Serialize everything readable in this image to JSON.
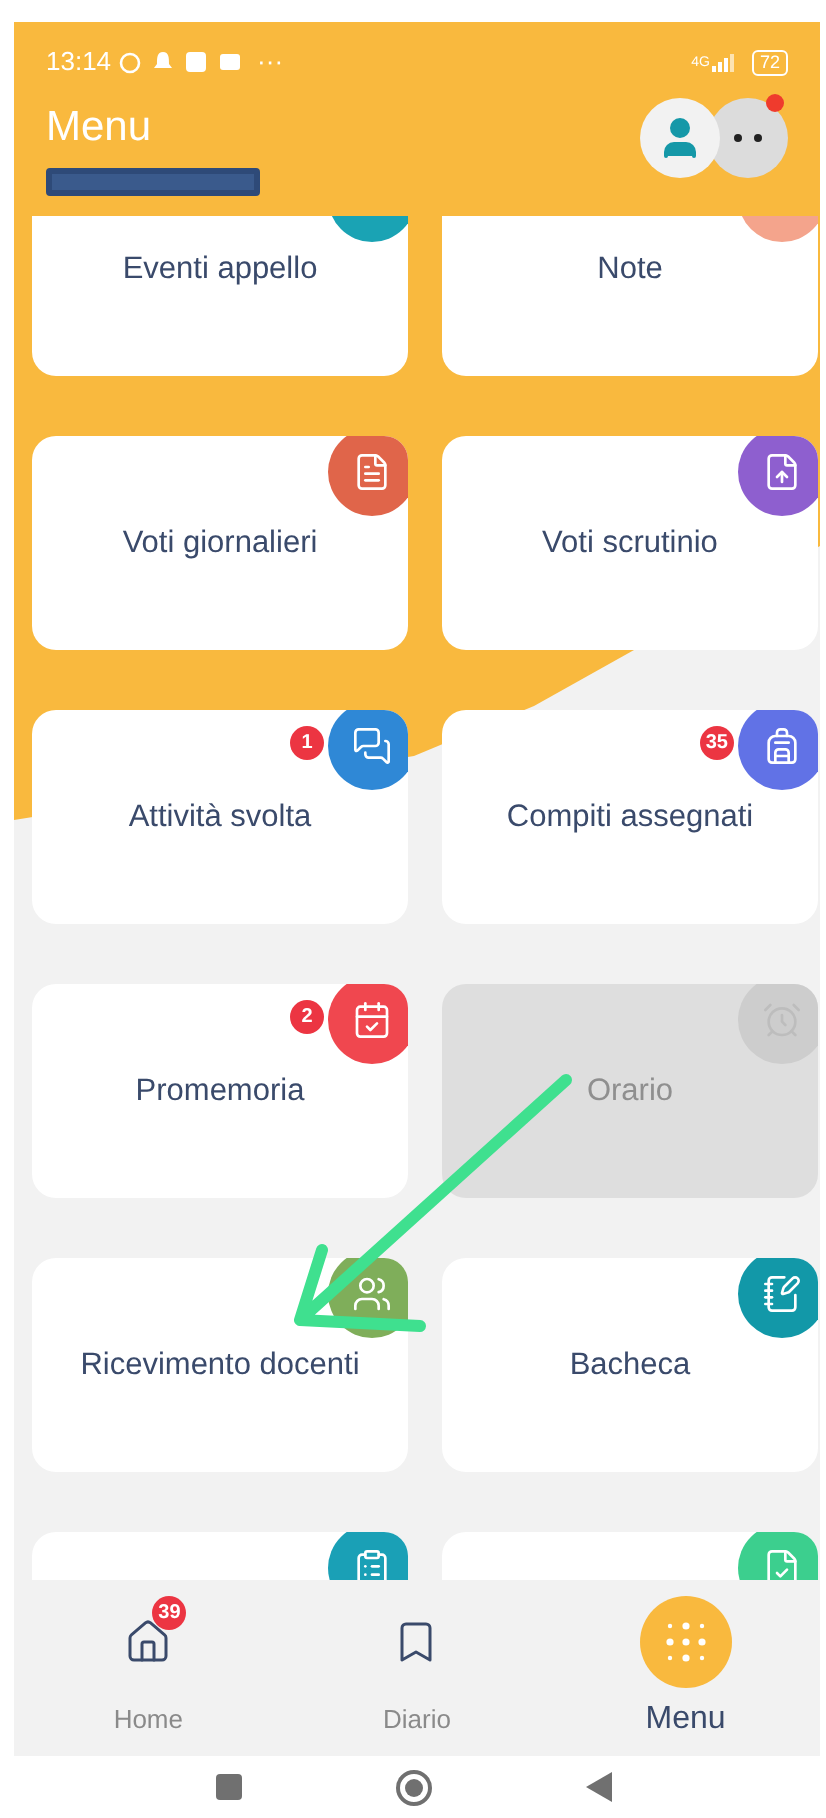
{
  "status_bar": {
    "time": "13:14",
    "more": "···",
    "network": "4G",
    "battery": "72"
  },
  "header": {
    "title": "Menu",
    "notification_dot": true
  },
  "cards": [
    {
      "label": "Eventi appello",
      "color": "#1aa3b4",
      "disabled": false
    },
    {
      "label": "Note",
      "color": "#f4a48c",
      "disabled": false
    },
    {
      "label": "Voti giornalieri",
      "color": "#e0654a",
      "disabled": false
    },
    {
      "label": "Voti scrutinio",
      "color": "#8e5fcf",
      "disabled": false
    },
    {
      "label": "Attività svolta",
      "color": "#2f88d6",
      "badge": "1",
      "disabled": false
    },
    {
      "label": "Compiti assegnati",
      "color": "#6172e6",
      "badge": "35",
      "disabled": false
    },
    {
      "label": "Promemoria",
      "color": "#f0474f",
      "badge": "2",
      "disabled": false
    },
    {
      "label": "Orario",
      "color": "#cdcdcd",
      "disabled": true
    },
    {
      "label": "Ricevimento docenti",
      "color": "#7fae5a",
      "disabled": false
    },
    {
      "label": "Bacheca",
      "color": "#1298a8",
      "disabled": false
    },
    {
      "color": "#1aa0b6",
      "disabled": false
    },
    {
      "color": "#3ccf8e",
      "disabled": false
    }
  ],
  "bottom_nav": [
    {
      "label": "Home",
      "badge": "39",
      "selected": false
    },
    {
      "label": "Diario",
      "selected": false
    },
    {
      "label": "Menu",
      "selected": true
    }
  ]
}
